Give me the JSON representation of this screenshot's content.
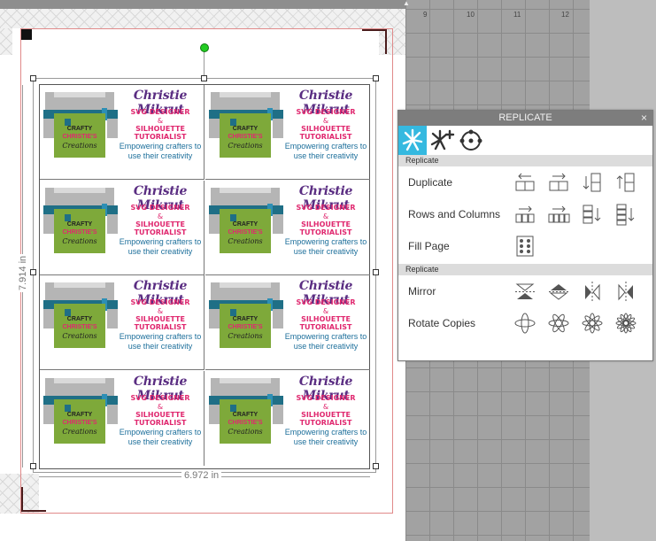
{
  "ruler": {
    "ticks": [
      "9",
      "10",
      "11",
      "12"
    ]
  },
  "page": {
    "width_label": "6.972 in",
    "height_label": "7.914 in"
  },
  "card": {
    "name": "Christie Mikrut",
    "title1": "SVG DESIGNER",
    "amp": "&",
    "title2": "SILHOUETTE TUTORIALIST",
    "tagline1": "Empowering crafters to",
    "tagline2": "use their creativity",
    "logo_line1": "CRAFTY",
    "logo_line2": "CHRISTIE'S",
    "logo_line3": "Creations"
  },
  "panel": {
    "title": "REPLICATE",
    "close_icon": "×",
    "tabs": [
      "replicate-tab",
      "replicate-special-tab",
      "radial-tab"
    ],
    "section1": "Replicate",
    "section2": "Replicate",
    "rows": [
      {
        "label": "Duplicate"
      },
      {
        "label": "Rows and Columns"
      },
      {
        "label": "Fill Page"
      },
      {
        "label": "Mirror"
      },
      {
        "label": "Rotate Copies"
      }
    ]
  },
  "colors": {
    "accent": "#35b9e0",
    "name": "#5a2d82",
    "pink": "#e0286f",
    "blue": "#1d6f9b",
    "green": "#7ea93a"
  }
}
